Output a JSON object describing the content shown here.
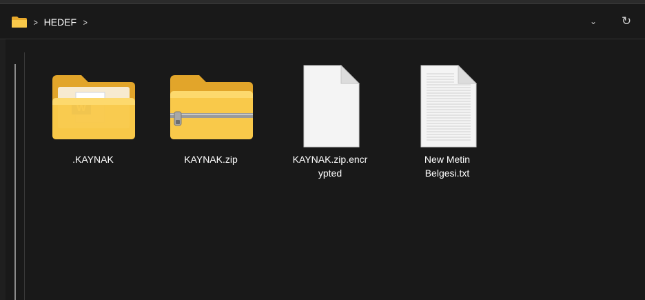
{
  "breadcrumb": {
    "items": [
      {
        "label": "HEDEF"
      }
    ]
  },
  "addressbar": {
    "dropdown_glyph": "⌄",
    "refresh_glyph": "↻"
  },
  "files": [
    {
      "name": ".KAYNAK",
      "kind": "folder-with-document",
      "icon": "folder-icon"
    },
    {
      "name": "KAYNAK.zip",
      "kind": "zip-folder",
      "icon": "zip-folder-icon"
    },
    {
      "name": "KAYNAK.zip.encr\nypted",
      "kind": "file",
      "icon": "file-icon"
    },
    {
      "name": "New Metin\nBelgesi.txt",
      "kind": "text-document",
      "icon": "text-file-icon"
    }
  ],
  "colors": {
    "background": "#191919",
    "folder_yellow": "#f5c242",
    "folder_light": "#ffd76b"
  }
}
